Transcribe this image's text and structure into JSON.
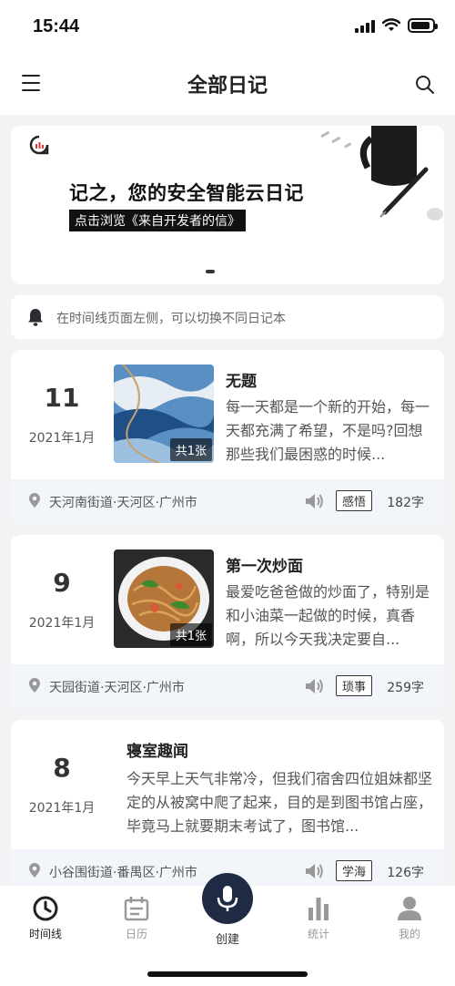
{
  "status_bar": {
    "time": "15:44"
  },
  "navbar": {
    "title": "全部日记",
    "menu_icon": "hamburger-icon",
    "search_icon": "search-icon"
  },
  "banner": {
    "headline": "记之，您的安全智能云日记",
    "subline": "点击浏览《来自开发者的信》"
  },
  "tip": {
    "text": "在时间线页面左侧，可以切换不同日记本"
  },
  "entries": [
    {
      "day": "11",
      "month": "2021年1月",
      "photo_count": "共1张",
      "title": "无题",
      "body": "每一天都是一个新的开始，每一天都充满了希望，不是吗?回想那些我们最困惑的时候...",
      "location": "天河南街道·天河区·广州市",
      "tag": "感悟",
      "words": "182字"
    },
    {
      "day": "9",
      "month": "2021年1月",
      "photo_count": "共1张",
      "title": "第一次炒面",
      "body": "最爱吃爸爸做的炒面了，特别是和小油菜一起做的时候，真香啊，所以今天我决定要自...",
      "location": "天园街道·天河区·广州市",
      "tag": "琐事",
      "words": "259字"
    },
    {
      "day": "8",
      "month": "2021年1月",
      "title": "寝室趣闻",
      "body": "今天早上天气非常冷，但我们宿舍四位姐妹都坚定的从被窝中爬了起来，目的是到图书馆占座，毕竟马上就要期末考试了，图书馆...",
      "location": "小谷围街道·番禺区·广州市",
      "tag": "学海",
      "words": "126字"
    }
  ],
  "tabbar": {
    "tabs": [
      {
        "label": "时间线",
        "icon": "clock-icon",
        "active": true
      },
      {
        "label": "日历",
        "icon": "calendar-icon",
        "active": false
      },
      {
        "label": "统计",
        "icon": "bar-chart-icon",
        "active": false
      },
      {
        "label": "我的",
        "icon": "person-icon",
        "active": false
      }
    ],
    "create_label": "创建",
    "create_icon": "microphone-icon"
  }
}
